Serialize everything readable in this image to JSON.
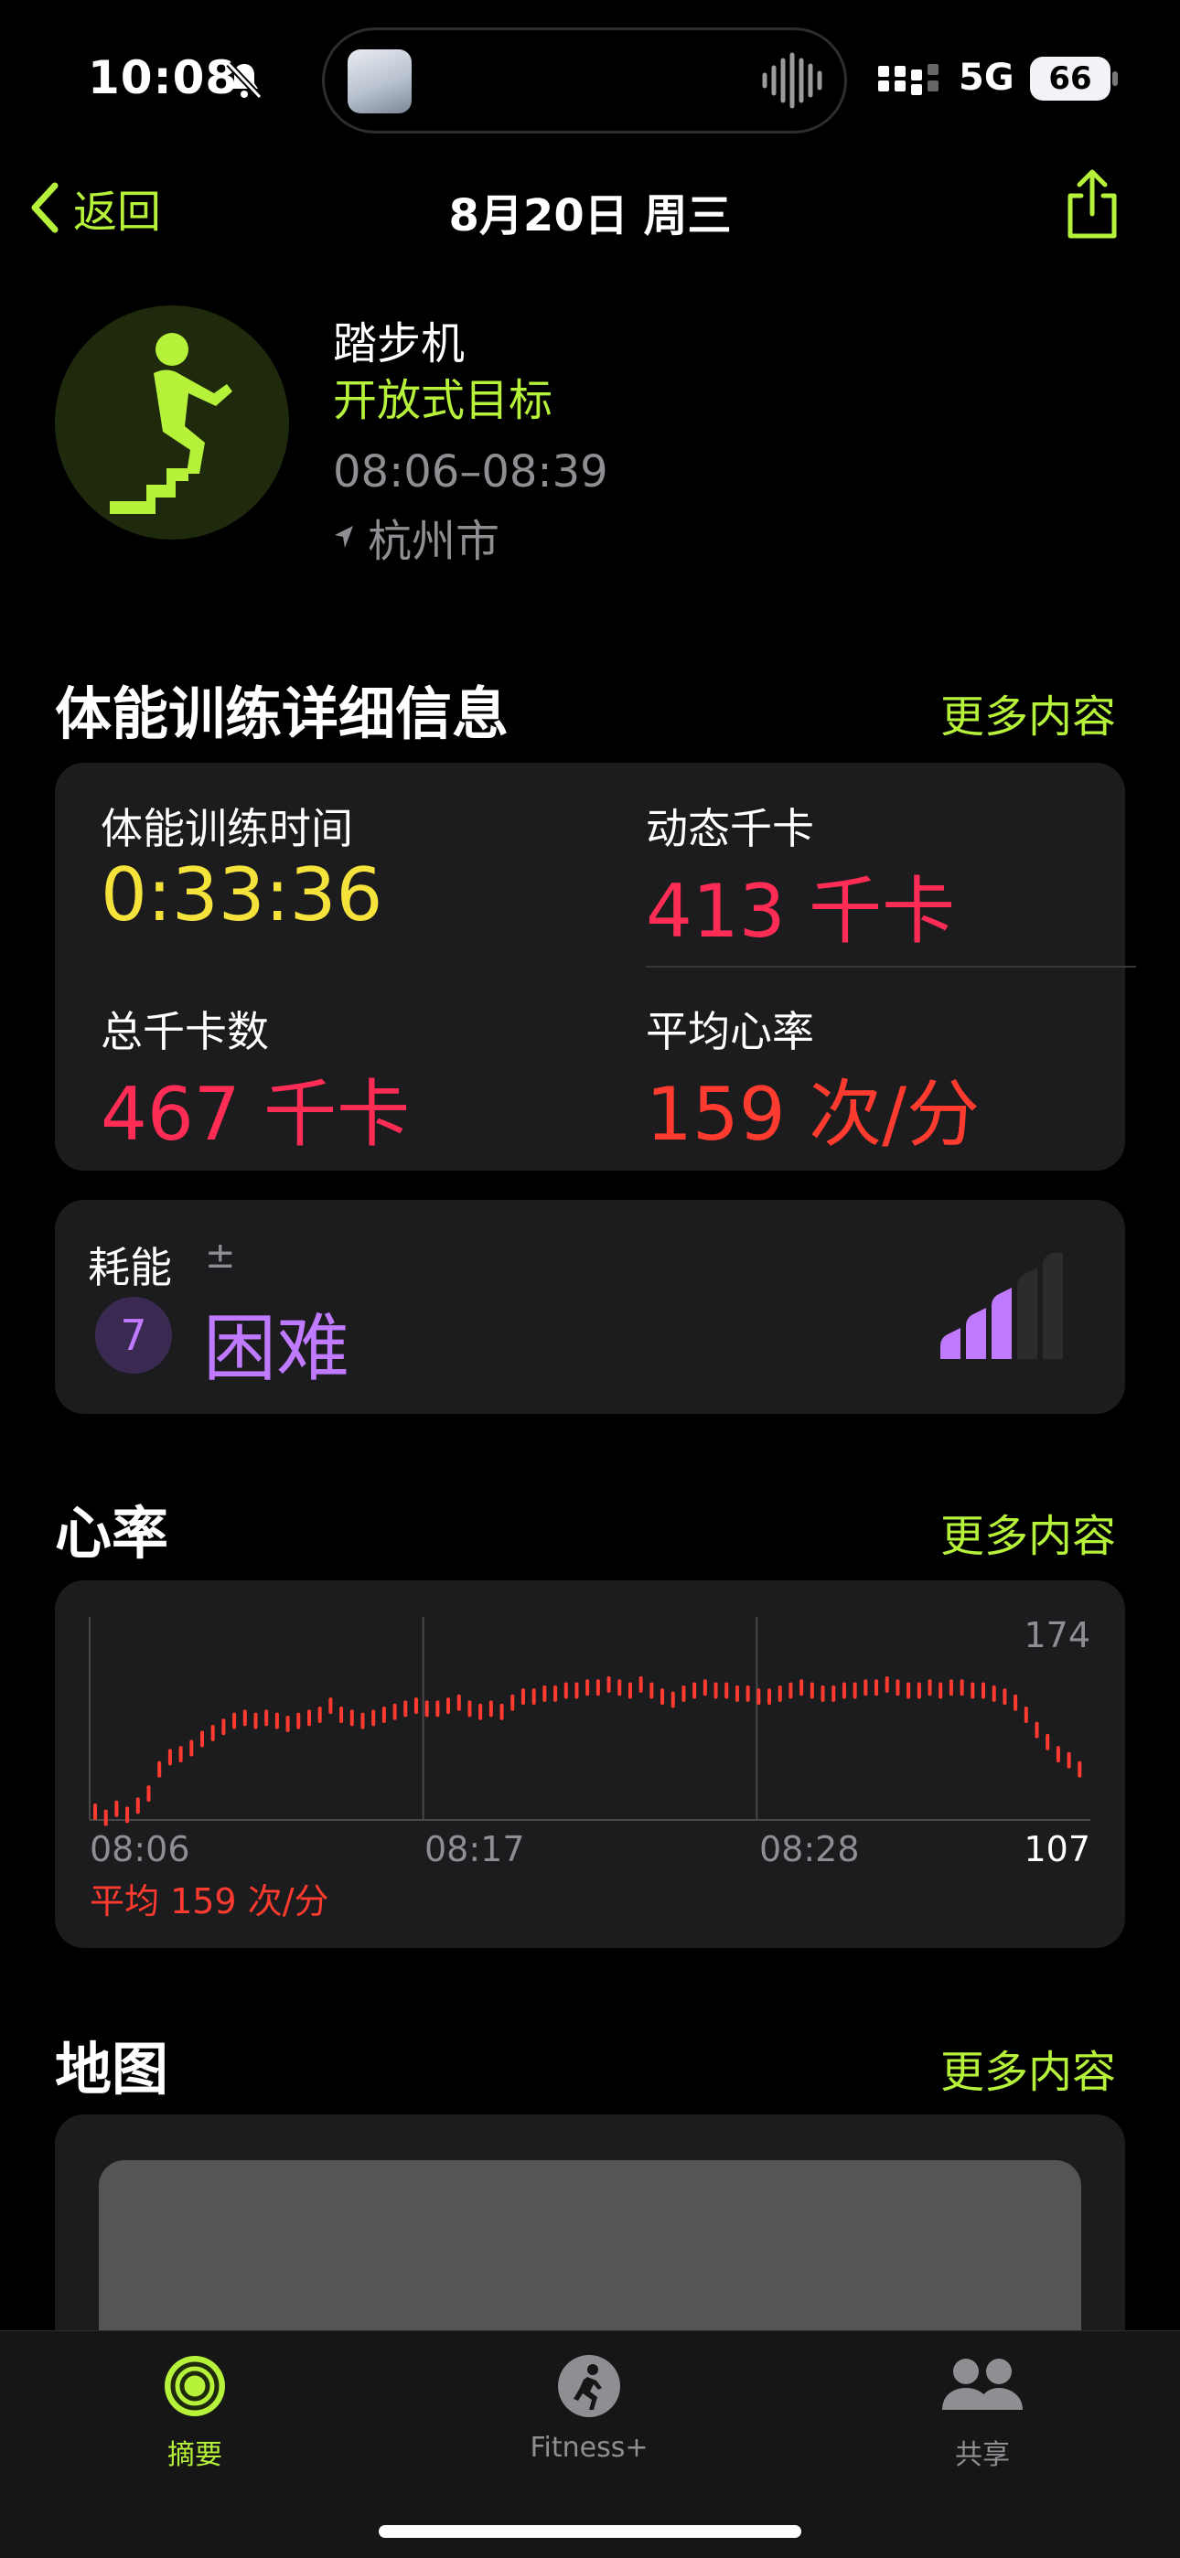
{
  "status": {
    "time": "10:08",
    "network": "5G",
    "battery": "66"
  },
  "nav": {
    "back_label": "返回",
    "title": "8月20日 周三"
  },
  "workout": {
    "activity": "踏步机",
    "goal": "开放式目标",
    "time_range": "08:06–08:39",
    "location": "杭州市"
  },
  "details": {
    "title": "体能训练详细信息",
    "more": "更多内容",
    "metrics": [
      {
        "label": "体能训练时间",
        "value": "0:33:36",
        "color": "#f5e33b"
      },
      {
        "label": "动态千卡",
        "value": "413 千卡",
        "color": "#ff2d55"
      },
      {
        "label": "总千卡数",
        "value": "467 千卡",
        "color": "#ff2d55"
      },
      {
        "label": "平均心率",
        "value": "159 次/分",
        "color": "#ff3b2f"
      }
    ]
  },
  "effort": {
    "label": "耗能",
    "adjust_symbol": "±",
    "score": "7",
    "level_text": "困难",
    "level": 0.7,
    "color": "#bf7aff"
  },
  "heart": {
    "title": "心率",
    "more": "更多内容",
    "max_label": "174",
    "min_label": "107",
    "avg_label": "平均 159 次/分",
    "chart_data": {
      "type": "bar",
      "x_ticks": [
        "08:06",
        "08:17",
        "08:28"
      ],
      "ylim": [
        107,
        174
      ],
      "values": [
        110,
        108,
        111,
        109,
        112,
        116,
        124,
        128,
        129,
        131,
        134,
        136,
        138,
        140,
        141,
        140,
        141,
        140,
        139,
        140,
        141,
        142,
        145,
        142,
        141,
        140,
        141,
        142,
        143,
        144,
        145,
        144,
        144,
        145,
        146,
        144,
        143,
        144,
        143,
        146,
        148,
        148,
        149,
        149,
        150,
        150,
        151,
        151,
        152,
        151,
        150,
        152,
        150,
        148,
        147,
        149,
        150,
        151,
        150,
        150,
        149,
        149,
        148,
        148,
        149,
        150,
        151,
        150,
        149,
        149,
        150,
        150,
        151,
        151,
        152,
        151,
        150,
        150,
        151,
        150,
        151,
        151,
        150,
        150,
        149,
        148,
        146,
        142,
        137,
        133,
        129,
        127,
        124
      ]
    }
  },
  "map": {
    "title": "地图",
    "more": "更多内容"
  },
  "tabs": [
    {
      "label": "摘要",
      "active": true
    },
    {
      "label": "Fitness+",
      "active": false
    },
    {
      "label": "共享",
      "active": false
    }
  ]
}
